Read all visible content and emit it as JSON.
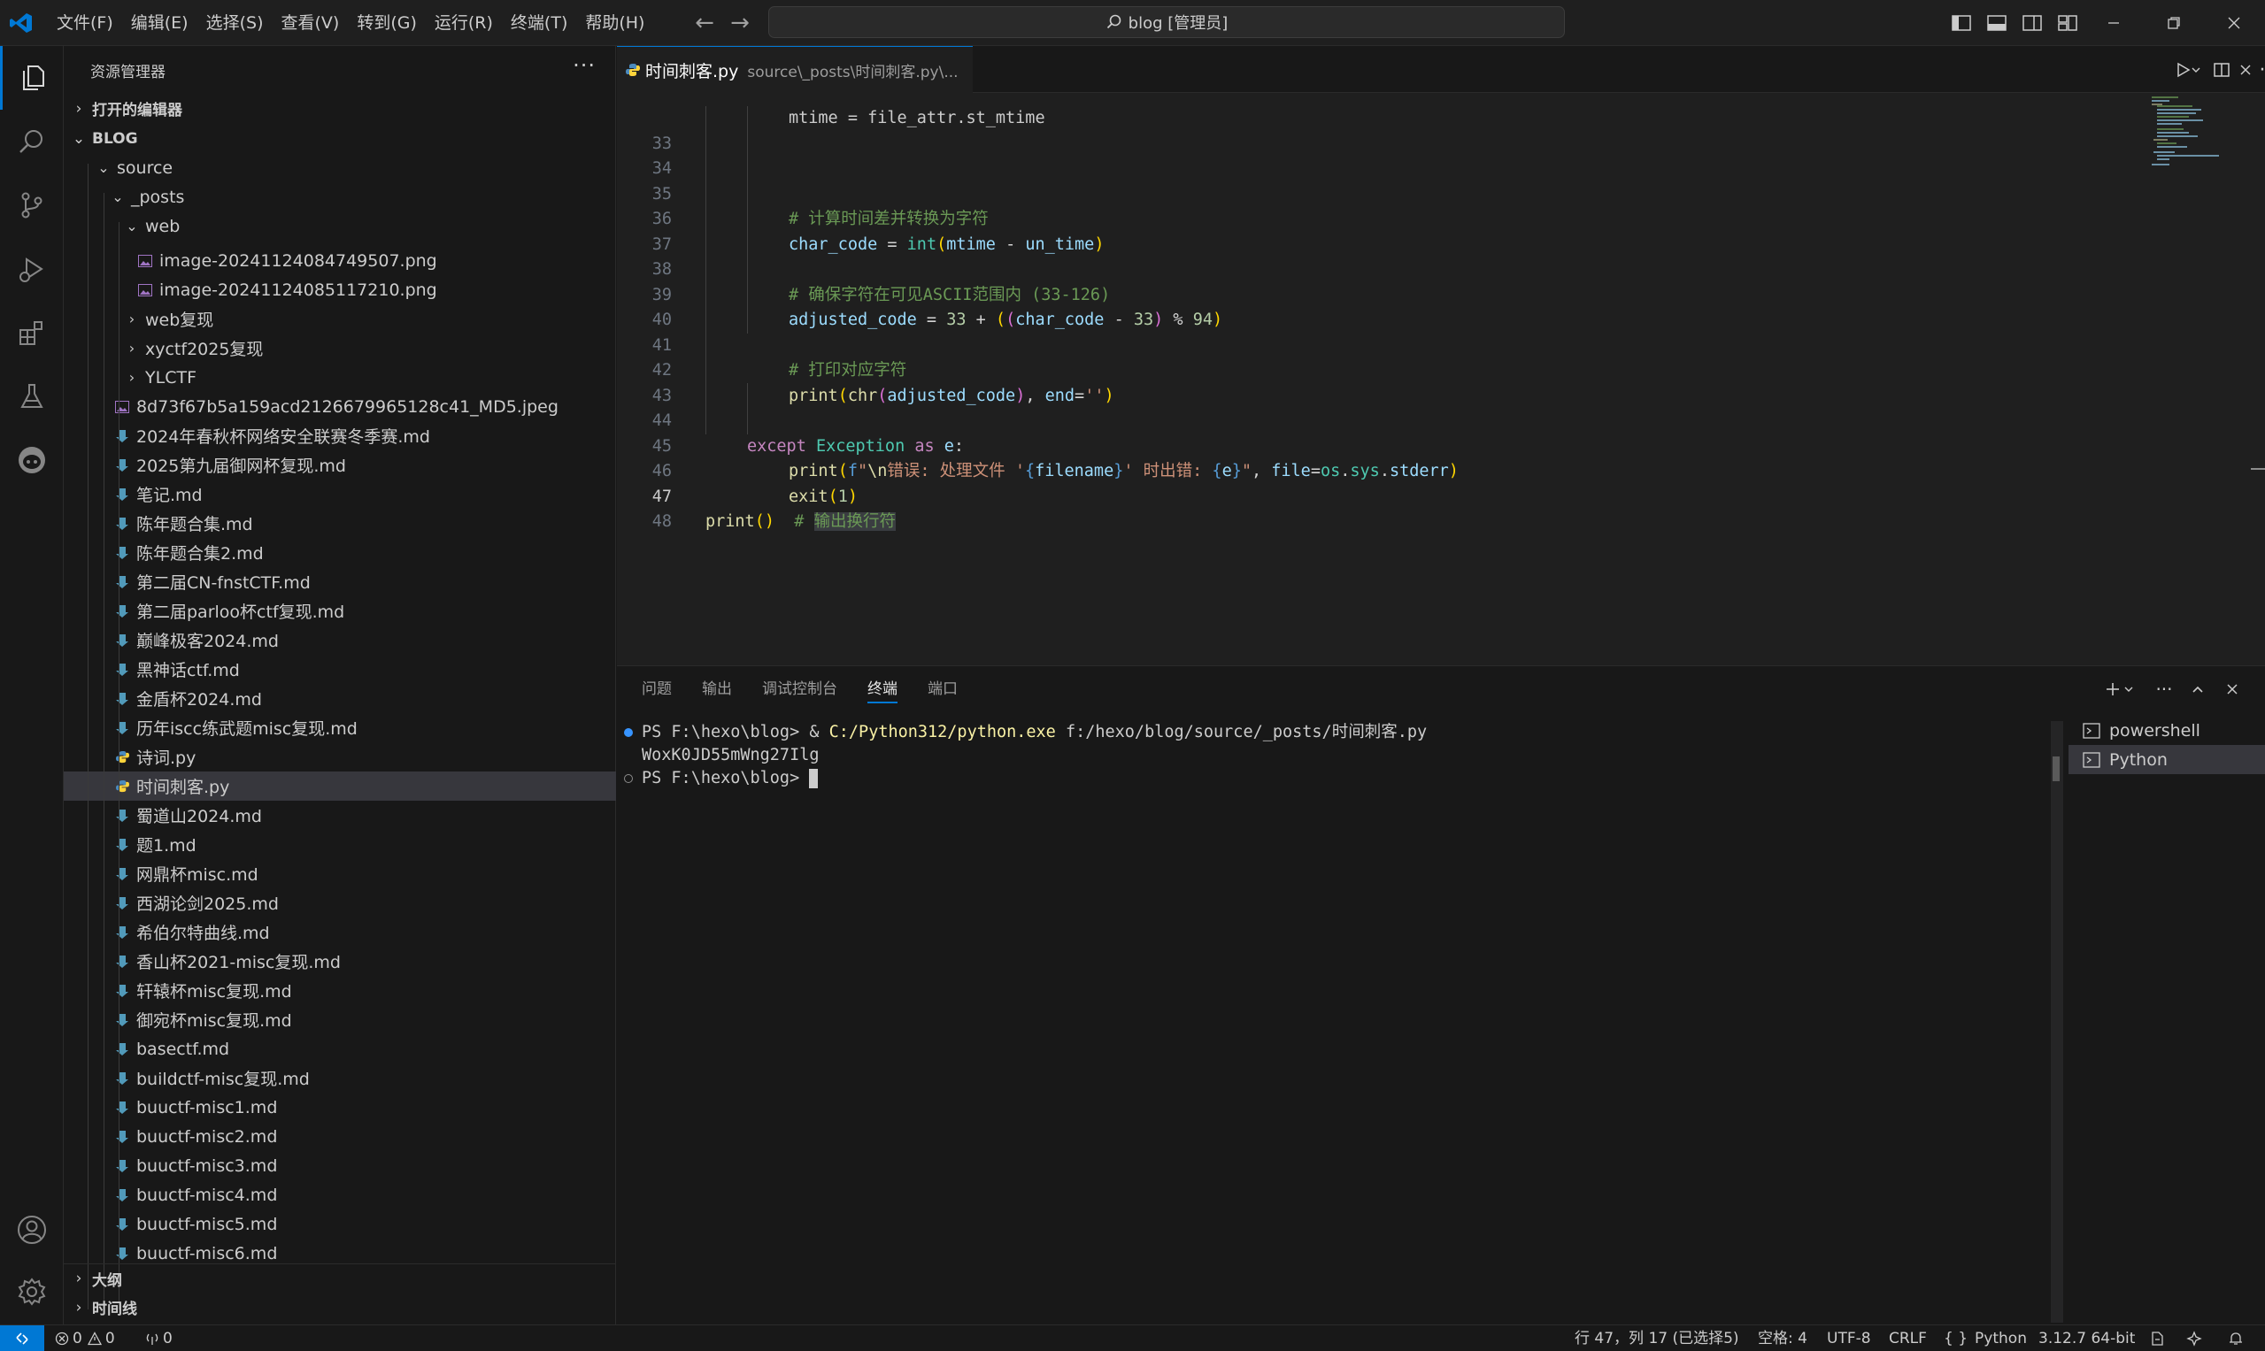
{
  "titlebar": {
    "menus": [
      "文件(F)",
      "编辑(E)",
      "选择(S)",
      "查看(V)",
      "转到(G)",
      "运行(R)",
      "终端(T)",
      "帮助(H)"
    ],
    "search_text": "blog [管理员]"
  },
  "sidebar": {
    "title": "资源管理器",
    "open_editors": "打开的编辑器",
    "workspace": "BLOG",
    "outline": "大纲",
    "timeline": "时间线",
    "tree": [
      {
        "label": "source",
        "type": "folder",
        "open": true,
        "depth": 1
      },
      {
        "label": "_posts",
        "type": "folder",
        "open": true,
        "depth": 2
      },
      {
        "label": "web",
        "type": "folder",
        "open": true,
        "depth": 3
      },
      {
        "label": "image-20241124084749507.png",
        "type": "image",
        "depth": 4
      },
      {
        "label": "image-20241124085117210.png",
        "type": "image",
        "depth": 4
      },
      {
        "label": "web复现",
        "type": "folder",
        "open": false,
        "depth": 3
      },
      {
        "label": "xyctf2025复现",
        "type": "folder",
        "open": false,
        "depth": 3
      },
      {
        "label": "YLCTF",
        "type": "folder",
        "open": false,
        "depth": 3
      },
      {
        "label": "8d73f67b5a159acd2126679965128c41_MD5.jpeg",
        "type": "image",
        "depth": 3
      },
      {
        "label": "2024年春秋杯网络安全联赛冬季赛.md",
        "type": "md",
        "depth": 3
      },
      {
        "label": "2025第九届御网杯复现.md",
        "type": "md",
        "depth": 3
      },
      {
        "label": "笔记.md",
        "type": "md",
        "depth": 3
      },
      {
        "label": "陈年题合集.md",
        "type": "md",
        "depth": 3
      },
      {
        "label": "陈年题合集2.md",
        "type": "md",
        "depth": 3
      },
      {
        "label": "第二届CN-fnstCTF.md",
        "type": "md",
        "depth": 3
      },
      {
        "label": "第二届parloo杯ctf复现.md",
        "type": "md",
        "depth": 3
      },
      {
        "label": "巅峰极客2024.md",
        "type": "md",
        "depth": 3
      },
      {
        "label": "黑神话ctf.md",
        "type": "md",
        "depth": 3
      },
      {
        "label": "金盾杯2024.md",
        "type": "md",
        "depth": 3
      },
      {
        "label": "历年iscc练武题misc复现.md",
        "type": "md",
        "depth": 3
      },
      {
        "label": "诗词.py",
        "type": "py",
        "depth": 3
      },
      {
        "label": "时间刺客.py",
        "type": "py",
        "depth": 3,
        "selected": true
      },
      {
        "label": "蜀道山2024.md",
        "type": "md",
        "depth": 3
      },
      {
        "label": "题1.md",
        "type": "md",
        "depth": 3
      },
      {
        "label": "网鼎杯misc.md",
        "type": "md",
        "depth": 3
      },
      {
        "label": "西湖论剑2025.md",
        "type": "md",
        "depth": 3
      },
      {
        "label": "希伯尔特曲线.md",
        "type": "md",
        "depth": 3
      },
      {
        "label": "香山杯2021-misc复现.md",
        "type": "md",
        "depth": 3
      },
      {
        "label": "轩辕杯misc复现.md",
        "type": "md",
        "depth": 3
      },
      {
        "label": "御宛杯misc复现.md",
        "type": "md",
        "depth": 3
      },
      {
        "label": "basectf.md",
        "type": "md",
        "depth": 3
      },
      {
        "label": "buildctf-misc复现.md",
        "type": "md",
        "depth": 3
      },
      {
        "label": "buuctf-misc1.md",
        "type": "md",
        "depth": 3
      },
      {
        "label": "buuctf-misc2.md",
        "type": "md",
        "depth": 3
      },
      {
        "label": "buuctf-misc3.md",
        "type": "md",
        "depth": 3
      },
      {
        "label": "buuctf-misc4.md",
        "type": "md",
        "depth": 3
      },
      {
        "label": "buuctf-misc5.md",
        "type": "md",
        "depth": 3
      },
      {
        "label": "buuctf-misc6.md",
        "type": "md",
        "depth": 3
      }
    ]
  },
  "editor": {
    "tab_title": "时间刺客.py",
    "tab_description": "source\\_posts\\时间刺客.py\\...",
    "partial_top_line": "mtime = file_attr.st_mtime",
    "lines": [
      {
        "n": "33",
        "text": ""
      },
      {
        "n": "34",
        "text": "# 计算时间差并转换为字符"
      },
      {
        "n": "35",
        "text": "char_code = int(mtime - un_time)"
      },
      {
        "n": "36",
        "text": ""
      },
      {
        "n": "37",
        "text": "# 确保字符在可见ASCII范围内 (33-126)"
      },
      {
        "n": "38",
        "text": "adjusted_code = 33 + ((char_code - 33) % 94)"
      },
      {
        "n": "39",
        "text": ""
      },
      {
        "n": "40",
        "text": "# 打印对应字符"
      },
      {
        "n": "41",
        "text": "print(chr(adjusted_code), end='')"
      },
      {
        "n": "42",
        "text": ""
      },
      {
        "n": "43",
        "text": "except Exception as e:"
      },
      {
        "n": "44",
        "text": "print(f\"\\n错误: 处理文件 '{filename}' 时出错: {e}\", file=os.sys.stderr)"
      },
      {
        "n": "45",
        "text": "exit(1)"
      },
      {
        "n": "46",
        "text": ""
      },
      {
        "n": "47",
        "text": "print()  # 输出换行符"
      },
      {
        "n": "48",
        "text": ""
      }
    ]
  },
  "panel": {
    "tabs": [
      "问题",
      "输出",
      "调试控制台",
      "终端",
      "端口"
    ],
    "active_tab": "终端",
    "terminal": {
      "prompt1": "PS F:\\hexo\\blog> ",
      "cmd_amp": "& ",
      "cmd_exe": "C:/Python312/python.exe",
      "cmd_arg": " f:/hexo/blog/source/_posts/时间刺客.py",
      "output": "WoxK0JD55mWng27Ilg",
      "prompt2": "PS F:\\hexo\\blog> "
    },
    "terminals": [
      "powershell",
      "Python"
    ]
  },
  "statusbar": {
    "errors": "0",
    "warnings": "0",
    "ports": "0",
    "position": "行 47，列 17 (已选择5)",
    "spaces": "空格: 4",
    "encoding": "UTF-8",
    "eol": "CRLF",
    "language": "Python",
    "interpreter": "3.12.7 64-bit"
  },
  "colors": {
    "accent": "#0078d4",
    "background": "#1f1f1f",
    "sidebar": "#181818",
    "selection": "#37373d"
  }
}
